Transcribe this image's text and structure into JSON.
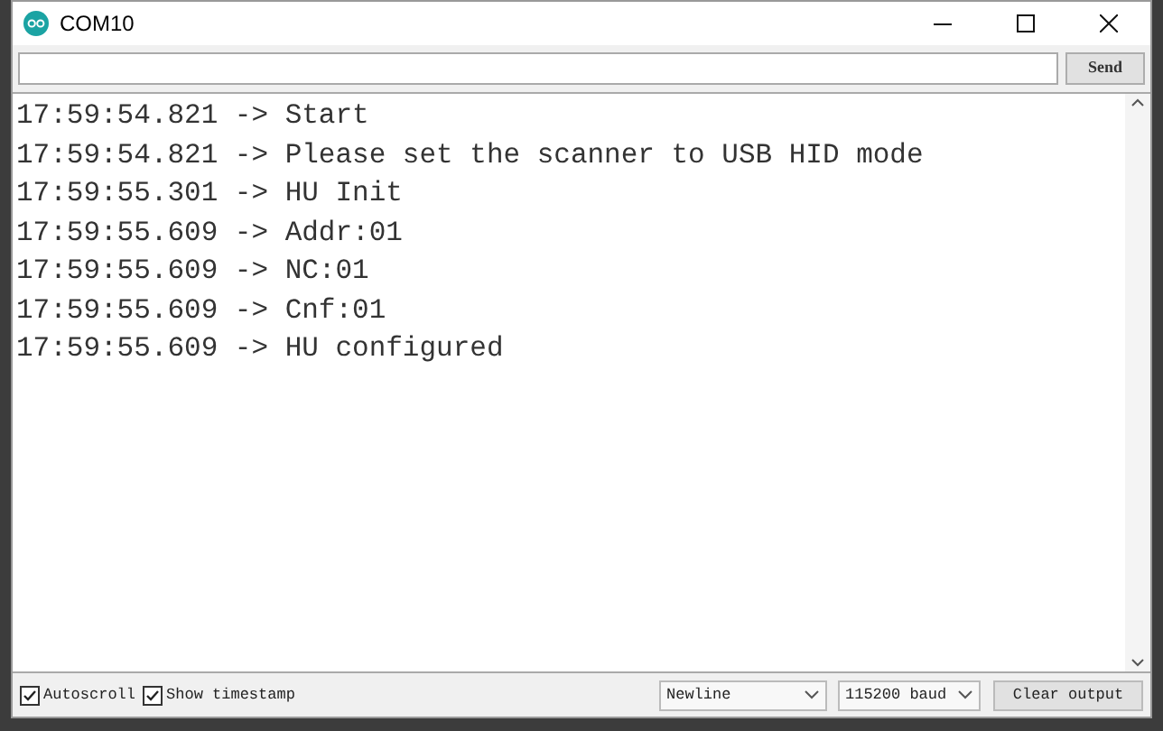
{
  "window": {
    "title": "COM10"
  },
  "send_row": {
    "button": "Send"
  },
  "output_lines": [
    "17:59:54.821 -> Start",
    "17:59:54.821 -> Please set the scanner to USB HID mode",
    "17:59:55.301 -> HU Init",
    "17:59:55.609 -> Addr:01",
    "17:59:55.609 -> NC:01",
    "17:59:55.609 -> Cnf:01",
    "17:59:55.609 -> HU configured"
  ],
  "bottom_bar": {
    "options": [
      {
        "label": "Autoscroll",
        "checked": true
      },
      {
        "label": "Show timestamp",
        "checked": true
      }
    ],
    "line_ending": "Newline",
    "baud": "115200 baud",
    "clear_button": "Clear output"
  }
}
